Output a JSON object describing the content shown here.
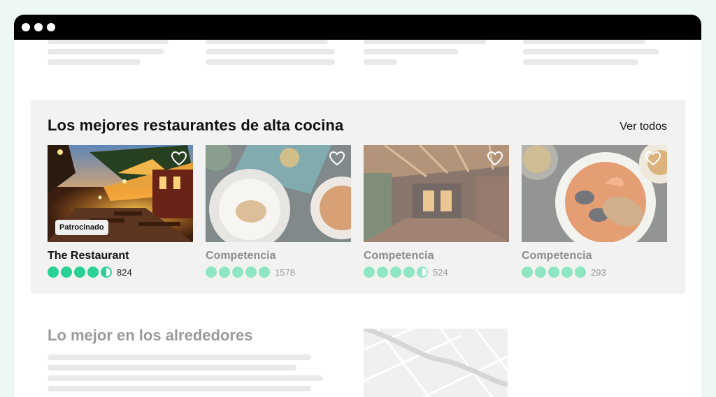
{
  "browser": {
    "window_dots": [
      "window-dot-1",
      "window-dot-2",
      "window-dot-3"
    ]
  },
  "featured": {
    "title": "Los mejores restaurantes de alta cocina",
    "see_all_label": "Ver todos",
    "cards": [
      {
        "name": "The Restaurant",
        "badge": "Patrocinado",
        "rating": 4.5,
        "review_count": "824",
        "highlighted": true
      },
      {
        "name": "Competencia",
        "rating": 5,
        "review_count": "1578",
        "highlighted": false
      },
      {
        "name": "Competencia",
        "rating": 4.5,
        "review_count": "524",
        "highlighted": false
      },
      {
        "name": "Competencia",
        "rating": 5,
        "review_count": "293",
        "highlighted": false
      }
    ]
  },
  "nearby": {
    "title": "Lo mejor en los alrededores"
  },
  "colors": {
    "rating_active": "#2bd193",
    "rating_muted": "#8ee6c3",
    "page_background": "#eef8f3",
    "section_background": "#f2f2f2"
  },
  "icons": [
    "heart-icon",
    "rating-bubble-icon",
    "map-thumbnail"
  ]
}
